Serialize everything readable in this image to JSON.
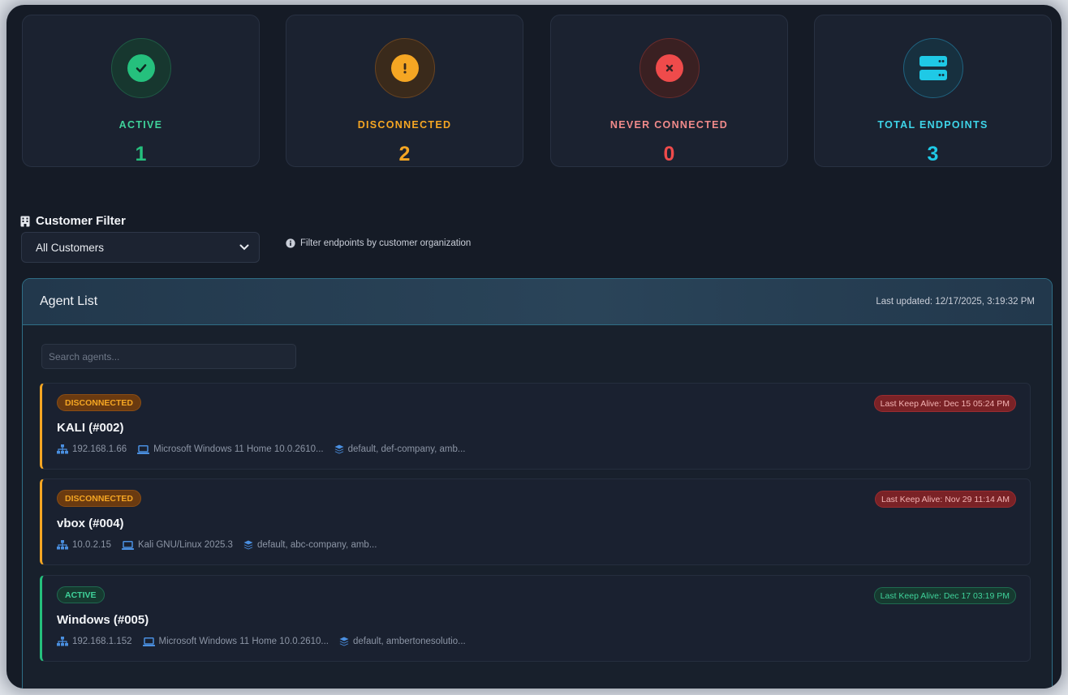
{
  "stats": [
    {
      "label": "ACTIVE",
      "value": "1",
      "color": "#25c07d",
      "icon": "check-circle-icon"
    },
    {
      "label": "DISCONNECTED",
      "value": "2",
      "color": "#f5a623",
      "icon": "exclamation-circle-icon"
    },
    {
      "label": "NEVER CONNECTED",
      "value": "0",
      "color": "#ef4b4b",
      "icon": "x-circle-icon"
    },
    {
      "label": "TOTAL ENDPOINTS",
      "value": "3",
      "color": "#1fc9e6",
      "icon": "server-icon"
    }
  ],
  "filter": {
    "title": "Customer Filter",
    "selected": "All Customers",
    "hint": "Filter endpoints by customer organization"
  },
  "agent_list": {
    "title": "Agent List",
    "last_updated": "Last updated: 12/17/2025, 3:19:32 PM",
    "search_placeholder": "Search agents..."
  },
  "agents": [
    {
      "status": "DISCONNECTED",
      "keep_alive": "Last Keep Alive: Dec 15 05:24 PM",
      "name": "KALI (#002)",
      "ip": "192.168.1.66",
      "os": "Microsoft Windows 11 Home 10.0.2610...",
      "groups": "default, def-company, amb..."
    },
    {
      "status": "DISCONNECTED",
      "keep_alive": "Last Keep Alive: Nov 29 11:14 AM",
      "name": "vbox (#004)",
      "ip": "10.0.2.15",
      "os": "Kali GNU/Linux 2025.3",
      "groups": "default, abc-company, amb..."
    },
    {
      "status": "ACTIVE",
      "keep_alive": "Last Keep Alive: Dec 17 03:19 PM",
      "name": "Windows (#005)",
      "ip": "192.168.1.152",
      "os": "Microsoft Windows 11 Home 10.0.2610...",
      "groups": "default, ambertonesolutio..."
    }
  ],
  "colors": {
    "active": "#25c07d",
    "disconnected": "#f5a623",
    "danger": "#ef4b4b",
    "info": "#1fc9e6",
    "meta_icon": "#4a8fe0"
  }
}
